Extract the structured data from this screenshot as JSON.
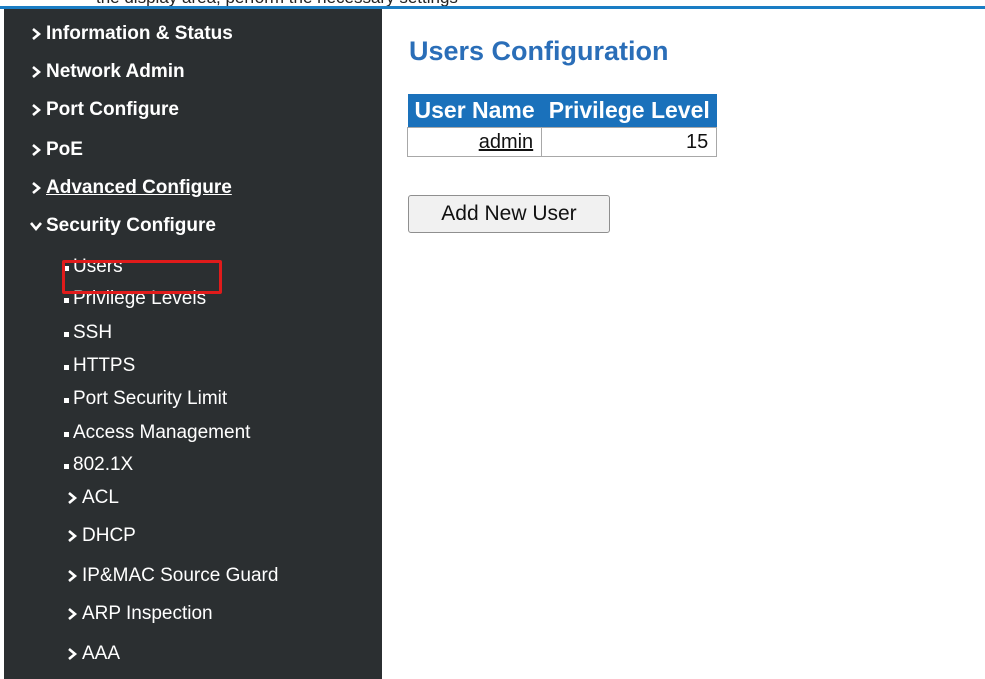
{
  "top_strip": {
    "clipped_text": "the display area, perform the necessary settings"
  },
  "sidebar": {
    "items": [
      {
        "label": "Information & Status",
        "icon": "chevron-right-icon"
      },
      {
        "label": "Network Admin",
        "icon": "chevron-right-icon"
      },
      {
        "label": "Port Configure",
        "icon": "chevron-right-icon"
      },
      {
        "label": "PoE",
        "icon": "chevron-right-icon"
      },
      {
        "label": "Advanced Configure",
        "icon": "chevron-right-icon"
      },
      {
        "label": "Security Configure",
        "icon": "chevron-down-icon",
        "expanded": true
      }
    ],
    "security_subitems": [
      {
        "label": "Users",
        "highlighted": true
      },
      {
        "label": "Privilege Levels"
      },
      {
        "label": "SSH"
      },
      {
        "label": "HTTPS"
      },
      {
        "label": "Port Security Limit"
      },
      {
        "label": "Access Management"
      },
      {
        "label": "802.1X"
      }
    ],
    "security_groups": [
      {
        "label": "ACL",
        "icon": "chevron-right-icon"
      },
      {
        "label": "DHCP",
        "icon": "chevron-right-icon"
      },
      {
        "label": "IP&MAC Source Guard",
        "icon": "chevron-right-icon"
      },
      {
        "label": "ARP Inspection",
        "icon": "chevron-right-icon"
      },
      {
        "label": "AAA",
        "icon": "chevron-right-icon"
      }
    ]
  },
  "main": {
    "title": "Users Configuration",
    "table": {
      "headers": [
        "User Name",
        "Privilege Level"
      ],
      "rows": [
        {
          "user_name": "admin",
          "privilege_level": "15"
        }
      ]
    },
    "add_button_label": "Add New User"
  },
  "colors": {
    "sidebar_bg": "#2b2f31",
    "title_blue": "#2a6eb8",
    "table_header_bg": "#1a71bb",
    "highlight_red": "#e01b1b",
    "accent_line": "#1a7dc4"
  }
}
